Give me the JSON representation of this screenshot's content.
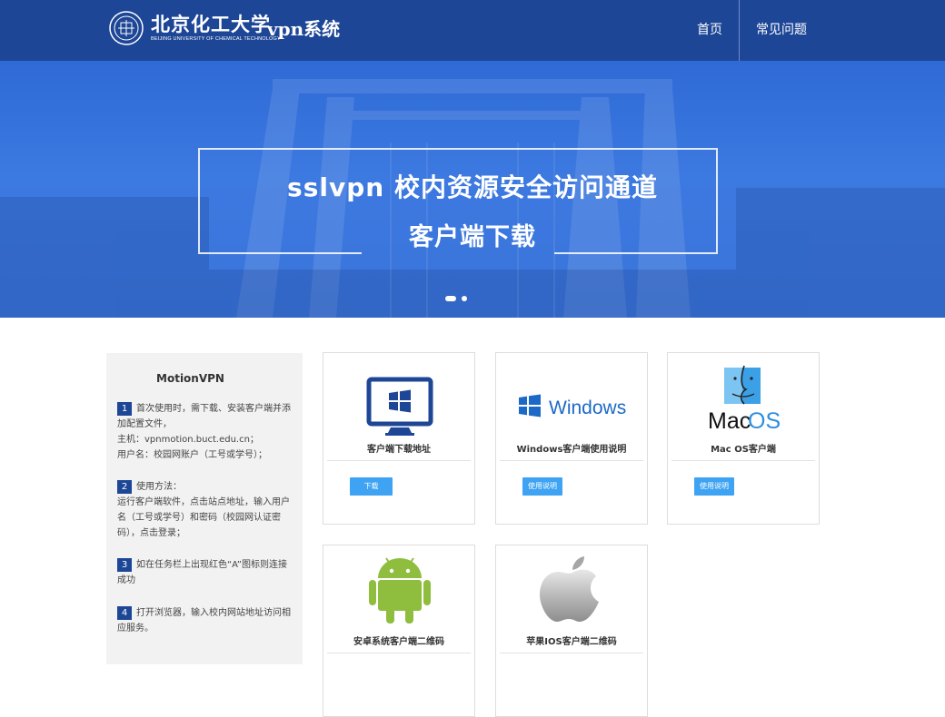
{
  "header": {
    "logo_cn": "北京化工大学",
    "logo_en": "BEIJING UNIVERSITY OF CHEMICAL TECHNOLOGY",
    "system_title": "vpn系统",
    "nav": [
      {
        "label": "首页"
      },
      {
        "label": "常见问题"
      }
    ]
  },
  "banner": {
    "line1": "sslvpn  校内资源安全访问通道",
    "line2": "客户端下载",
    "slides_total": 2,
    "slide_active": 1
  },
  "sidebar": {
    "title": "MotionVPN",
    "steps": [
      {
        "num": "1",
        "text": "首次使用时，需下载、安装客户端并添加配置文件，",
        "extra": [
          "主机：vpnmotion.buct.edu.cn；",
          "用户名：校园网账户（工号或学号）；"
        ]
      },
      {
        "num": "2",
        "text": "使用方法：",
        "extra": [
          "运行客户端软件，点击站点地址，输入用户名（工号或学号）和密码（校园网认证密码），点击登录；"
        ]
      },
      {
        "num": "3",
        "text": "如在任务栏上出现红色“A”图标则连接成功"
      },
      {
        "num": "4",
        "text": "打开浏览器，输入校内网站地址访问相应服务。"
      }
    ]
  },
  "cards": [
    {
      "title": "客户端下载地址",
      "button": "下载",
      "icon": "windows-monitor-icon"
    },
    {
      "title": "Windows客户端使用说明",
      "button": "使用说明",
      "icon": "windows-logo-icon",
      "logo_text": "Windows"
    },
    {
      "title": "Mac OS客户端",
      "button": "使用说明",
      "icon": "mac-os-logo-icon",
      "logo_text": "MacOS"
    },
    {
      "title": "安卓系统客户端二维码",
      "icon": "android-icon"
    },
    {
      "title": "苹果IOS客户端二维码",
      "icon": "apple-icon"
    }
  ],
  "colors": {
    "header_bg": "#1d4696",
    "banner_bg": "#3a74da",
    "button_bg": "#3ea3f3",
    "sidebar_bg": "#f2f2f2",
    "step_badge": "#1d4696"
  }
}
